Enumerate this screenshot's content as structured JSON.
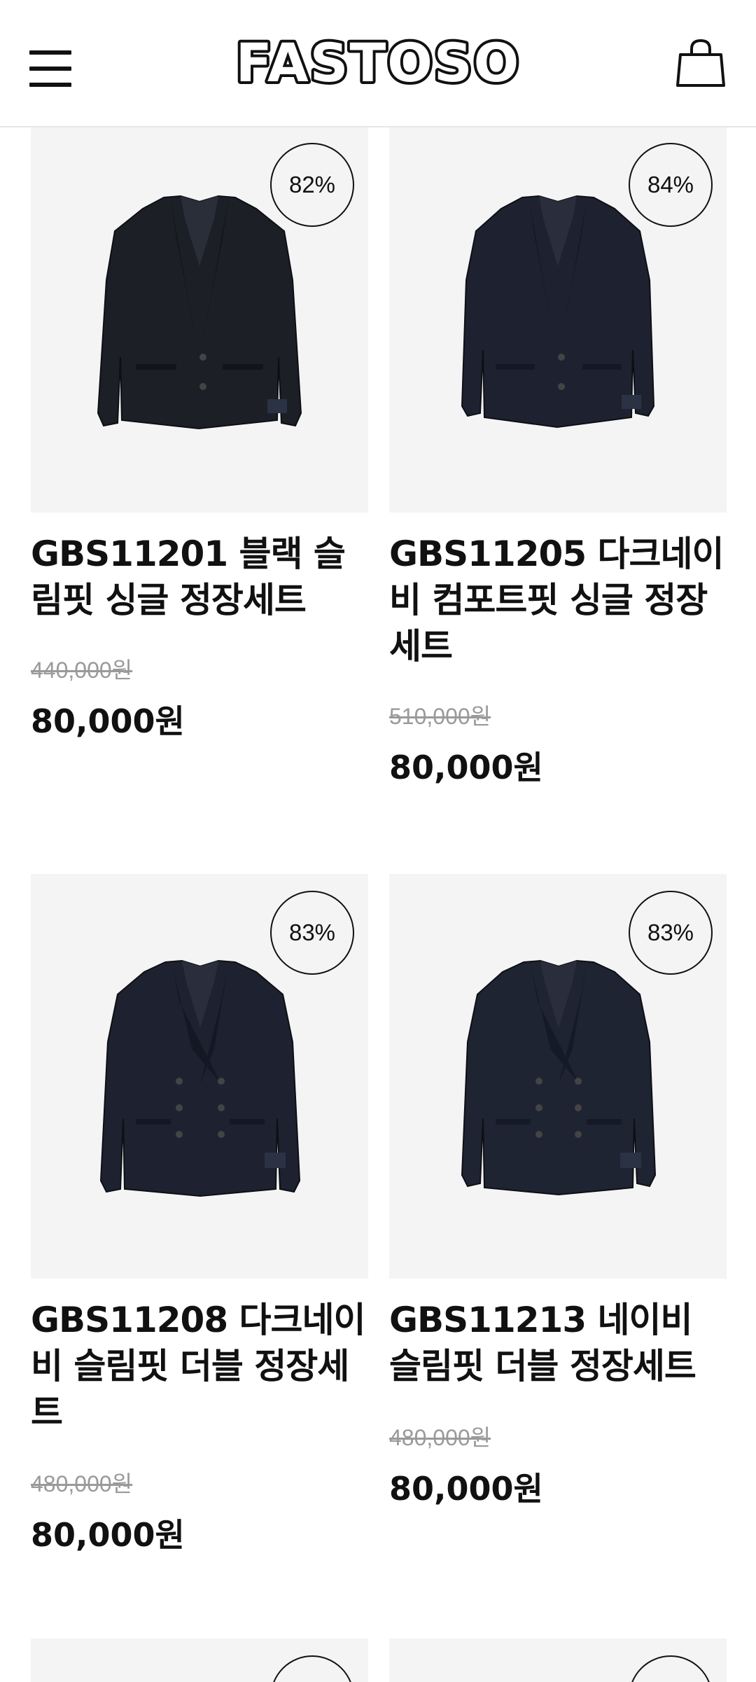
{
  "header": {
    "brand": "FASTOSO",
    "menu_icon": "hamburger-menu-icon",
    "cart_icon": "shopping-bag-icon"
  },
  "colors": {
    "background": "#ffffff",
    "image_bg": "#f4f4f4",
    "text": "#111111",
    "original_price": "#9a9a9a",
    "jacket": "#1c1f26"
  },
  "products": [
    {
      "discount": "82%",
      "name": "GBS11201 블랙 슬림핏 싱글 정장세트",
      "original_price": "440,000원",
      "price": "80,000원",
      "style": "single-breasted black jacket"
    },
    {
      "discount": "84%",
      "name": "GBS11205 다크네이비 컴포트핏 싱글 정장세트",
      "original_price": "510,000원",
      "price": "80,000원",
      "style": "single-breasted dark navy jacket"
    },
    {
      "discount": "83%",
      "name": "GBS11208 다크네이비 슬림핏 더블 정장세트",
      "original_price": "480,000원",
      "price": "80,000원",
      "style": "double-breasted dark navy jacket"
    },
    {
      "discount": "83%",
      "name": "GBS11213 네이비 슬림핏 더블 정장세트",
      "original_price": "480,000원",
      "price": "80,000원",
      "style": "double-breasted navy jacket"
    }
  ]
}
